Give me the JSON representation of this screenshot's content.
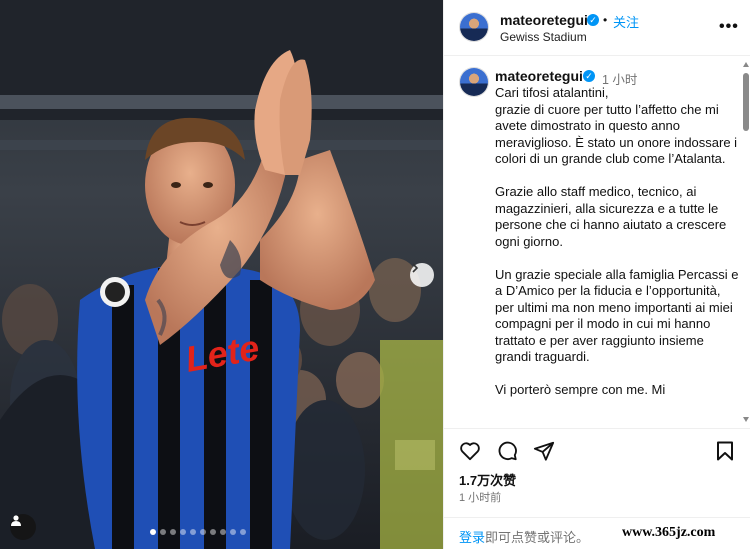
{
  "post": {
    "username": "mateoretegui",
    "follow_label": "关注",
    "separator": "•",
    "location": "Gewiss Stadium",
    "more_label": "•••",
    "caption_time": "1 小时",
    "caption_paragraphs": [
      "Cari tifosi atalantini,\ngrazie di cuore per tutto l’affetto che mi avete dimostrato in questo anno meraviglioso. È stato un onore indossare i colori di un grande club come l’Atalanta.",
      "Grazie allo staff medico, tecnico, ai magazzinieri, alla sicurezza e a tutte le persone che ci hanno aiutato a crescere ogni giorno.",
      "Un grazie speciale alla famiglia Percassi e a D’Amico per la fiducia e l’opportunità, per ultimi ma non meno importanti ai miei compagni per il modo in cui mi hanno trattato e per aver raggiunto insieme grandi traguardi.",
      "Vi porterò sempre con me. Mi"
    ],
    "likes": "1.7万次赞",
    "post_time": "1 小时前",
    "login_link": "登录",
    "login_rest": "即可点赞或评论。",
    "carousel": {
      "count": 10,
      "active": 0
    }
  },
  "photo": {
    "jersey_sponsor": "Lete",
    "icons": {
      "next": "chevron-right-icon",
      "user_tag": "user-icon"
    }
  },
  "watermark": "www.365jz.com",
  "colors": {
    "accent": "#0095f6",
    "muted": "#737373",
    "jersey_blue": "#1f4fb5",
    "jersey_black": "#0d0f14",
    "sponsor_red": "#e2231a"
  }
}
